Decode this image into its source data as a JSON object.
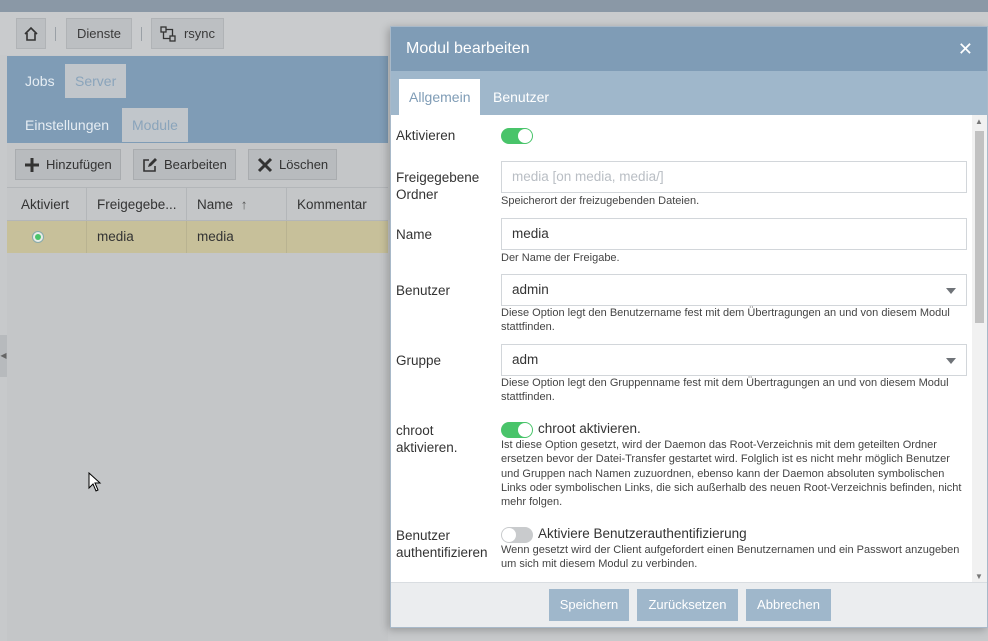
{
  "breadcrumb": {
    "services_label": "Dienste",
    "rsync_label": "rsync"
  },
  "panel": {
    "tabs_top": [
      "Jobs",
      "Server"
    ],
    "tabs_sub": [
      "Einstellungen",
      "Module"
    ],
    "toolbar": {
      "add_label": "Hinzufügen",
      "edit_label": "Bearbeiten",
      "delete_label": "Löschen"
    },
    "columns": [
      "Aktiviert",
      "Freigegebe...",
      "Name",
      "Kommentar"
    ],
    "rows": [
      {
        "enabled": true,
        "shared_folder": "media",
        "name": "media",
        "comment": ""
      }
    ]
  },
  "modal": {
    "title": "Modul bearbeiten",
    "tabs": [
      "Allgemein",
      "Benutzer"
    ],
    "fields": {
      "activate": {
        "label": "Aktivieren",
        "value": true
      },
      "shared_folder": {
        "label": "Freigegebene Ordner",
        "placeholder": "media [on media, media/]",
        "hint": "Speicherort der freizugebenden Dateien."
      },
      "name": {
        "label": "Name",
        "value": "media",
        "hint": "Der Name der Freigabe."
      },
      "user": {
        "label": "Benutzer",
        "value": "admin",
        "hint": "Diese Option legt den Benutzername fest mit dem Übertragungen an und von diesem Modul stattfinden."
      },
      "group": {
        "label": "Gruppe",
        "value": "adm",
        "hint": "Diese Option legt den Gruppenname fest mit dem Übertragungen an und von diesem Modul stattfinden."
      },
      "chroot": {
        "label": "chroot aktivieren.",
        "toggle_text": "chroot aktivieren.",
        "value": true,
        "hint": "Ist diese Option gesetzt, wird der Daemon das Root-Verzeichnis mit dem geteilten Ordner ersetzen bevor der Datei-Transfer gestartet wird. Folglich ist es nicht mehr möglich Benutzer und Gruppen nach Namen zuzuordnen, ebenso kann der Daemon absoluten symbolischen Links oder symbolischen Links, die sich außerhalb des neuen Root-Verzeichnis befinden, nicht mehr folgen."
      },
      "auth": {
        "label": "Benutzer authentifizieren",
        "toggle_text": "Aktiviere Benutzerauthentifizierung",
        "value": false,
        "hint": "Wenn gesetzt wird der Client aufgefordert einen Benutzernamen und ein Passwort anzugeben um sich mit diesem Modul zu verbinden."
      }
    },
    "buttons": {
      "save": "Speichern",
      "reset": "Zurücksetzen",
      "cancel": "Abbrechen"
    }
  },
  "colors": {
    "header_blue": "#7f9cb6",
    "tab_bar_blue": "#9fb7cb",
    "toggle_on": "#49c46a",
    "selected_row": "#c7c09a"
  }
}
